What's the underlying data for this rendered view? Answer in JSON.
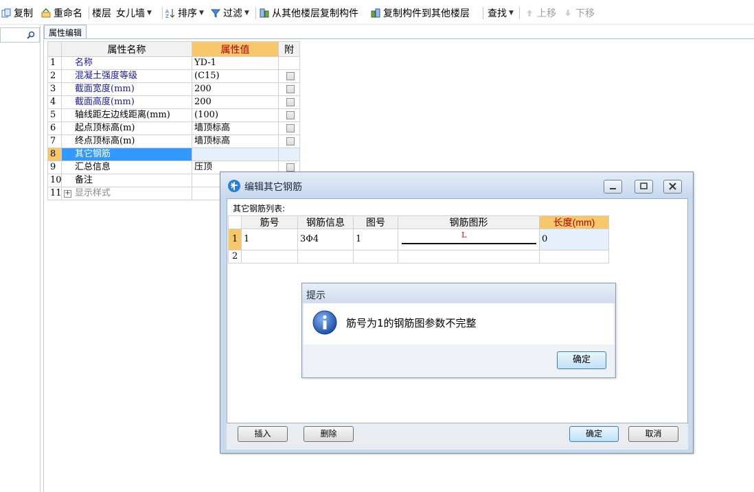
{
  "toolbar": {
    "copy": "复制",
    "rename": "重命名",
    "floor_label": "楼层",
    "floor_value": "女儿墙",
    "sort": "排序",
    "filter": "过滤",
    "copy_from_floor": "从其他楼层复制构件",
    "copy_to_floor": "复制构件到其他楼层",
    "find": "查找",
    "move_up": "上移",
    "move_down": "下移"
  },
  "tab": {
    "label": "属性编辑"
  },
  "grid": {
    "headers": {
      "name": "属性名称",
      "value": "属性值",
      "attach": "附"
    },
    "rows": [
      {
        "num": "1",
        "name": "名称",
        "value": "YD-1"
      },
      {
        "num": "2",
        "name": "混凝土强度等级",
        "value": "(C15)"
      },
      {
        "num": "3",
        "name": "截面宽度(mm)",
        "value": "200"
      },
      {
        "num": "4",
        "name": "截面高度(mm)",
        "value": "200"
      },
      {
        "num": "5",
        "name": "轴线距左边线距离(mm)",
        "value": "(100)"
      },
      {
        "num": "6",
        "name": "起点顶标高(m)",
        "value": "墙顶标高"
      },
      {
        "num": "7",
        "name": "终点顶标高(m)",
        "value": "墙顶标高"
      },
      {
        "num": "8",
        "name": "其它钢筋",
        "value": ""
      },
      {
        "num": "9",
        "name": "汇总信息",
        "value": "压顶"
      },
      {
        "num": "10",
        "name": "备注",
        "value": ""
      },
      {
        "num": "11",
        "name": "显示样式",
        "value": ""
      }
    ]
  },
  "rebar_dialog": {
    "title": "编辑其它钢筋",
    "list_label": "其它钢筋列表:",
    "headers": {
      "bar_no": "筋号",
      "bar_info": "钢筋信息",
      "fig_no": "图号",
      "shape": "钢筋图形",
      "length": "长度(mm)"
    },
    "rows": [
      {
        "num": "1",
        "bar_no": "1",
        "bar_info": "3Φ4",
        "fig_no": "1",
        "shape_label": "L",
        "length": "0"
      },
      {
        "num": "2",
        "bar_no": "",
        "bar_info": "",
        "fig_no": "",
        "shape_label": "",
        "length": ""
      }
    ],
    "insert": "插入",
    "delete": "删除",
    "ok": "确定",
    "cancel": "取消"
  },
  "message_box": {
    "title": "提示",
    "text": "筋号为1的钢筋图参数不完整",
    "ok": "确定"
  },
  "colors": {
    "header_highlight": "#f7c86a",
    "selection": "#3399ff",
    "link_blue": "#1a1aa0",
    "shape_label": "#e00000"
  }
}
